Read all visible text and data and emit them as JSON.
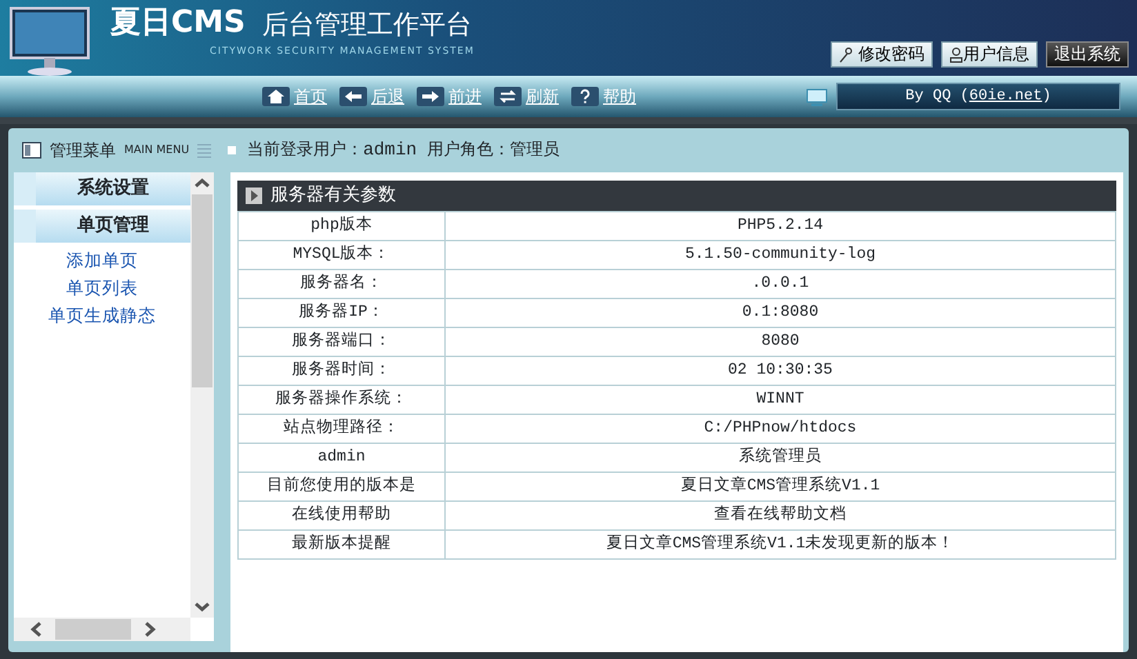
{
  "header": {
    "logo_title": "夏日CMS",
    "logo_subtitle": "后台管理工作平台",
    "tagline": "CITYWORK SECURITY MANAGEMENT SYSTEM",
    "top_buttons": [
      {
        "label": "修改密码",
        "kind": "key"
      },
      {
        "label": "用户信息",
        "kind": "user"
      },
      {
        "label": "退出系统",
        "kind": "exit"
      }
    ]
  },
  "nav": {
    "links": [
      {
        "label": "首页",
        "kind": "home"
      },
      {
        "label": "后退",
        "kind": "back"
      },
      {
        "label": "前进",
        "kind": "forward"
      },
      {
        "label": "刷新",
        "kind": "refresh"
      },
      {
        "label": "帮助",
        "kind": "help"
      }
    ],
    "credit_prefix": "By QQ (",
    "credit_link": "60ie.net",
    "credit_suffix": ")"
  },
  "sidebar": {
    "title": "管理菜单",
    "subtitle": "MAIN MENU",
    "sections": [
      {
        "label": "系统设置"
      },
      {
        "label": "单页管理",
        "children": [
          {
            "label": "添加单页"
          },
          {
            "label": "单页列表"
          },
          {
            "label": "单页生成静态"
          }
        ]
      }
    ]
  },
  "login_info": {
    "user_label": "当前登录用户：",
    "user": "admin",
    "role_label": "用户角色：",
    "role": "管理员"
  },
  "panel": {
    "title": "服务器有关参数",
    "rows": [
      [
        "php版本",
        "PHP5.2.14"
      ],
      [
        "MYSQL版本：",
        "5.1.50-community-log"
      ],
      [
        "服务器名：",
        ".0.0.1"
      ],
      [
        "服务器IP：",
        "0.1:8080"
      ],
      [
        "服务器端口：",
        "8080"
      ],
      [
        "服务器时间：",
        "02 10:30:35"
      ],
      [
        "服务器操作系统：",
        "WINNT"
      ],
      [
        "站点物理路径：",
        "C:/PHPnow/htdocs"
      ],
      [
        "admin",
        "系统管理员"
      ],
      [
        "目前您使用的版本是",
        "夏日文章CMS管理系统V1.1"
      ],
      [
        "在线使用帮助",
        "查看在线帮助文档"
      ],
      [
        "最新版本提醒",
        "夏日文章CMS管理系统V1.1未发现更新的版本！"
      ]
    ]
  }
}
